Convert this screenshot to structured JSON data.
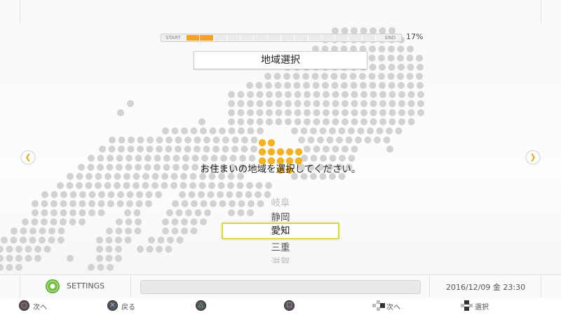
{
  "progress": {
    "start_label": "START",
    "end_label": "END",
    "percent_text": "17%",
    "percent": 17,
    "segments": 14,
    "filled_segments": 2,
    "fill_color": "#f4a420"
  },
  "title": "地域選択",
  "prompt": "お住まいの地域を選択してください。",
  "picker": {
    "items": [
      {
        "label": "岐阜",
        "state": "far"
      },
      {
        "label": "静岡",
        "state": "near"
      },
      {
        "label": "愛知",
        "state": "selected"
      },
      {
        "label": "三重",
        "state": "near"
      },
      {
        "label": "滋賀",
        "state": "far"
      }
    ],
    "selected_border_color": "#d9d64a"
  },
  "nav": {
    "left_icon": "chevron-left-icon",
    "right_icon": "chevron-right-icon",
    "accent_color": "#e6a21a"
  },
  "map": {
    "dot_color": "#d2d2d2",
    "highlight_color": "#f4b223",
    "highlighted_region": "愛知"
  },
  "settings_bar": {
    "label": "SETTINGS",
    "icon": "gear-icon",
    "datetime": "2016/12/09 金 23:30"
  },
  "button_bar": [
    {
      "icon": "circle-button-icon",
      "label": "次へ"
    },
    {
      "icon": "cross-button-icon",
      "label": "戻る"
    },
    {
      "icon": "triangle-button-icon",
      "label": ""
    },
    {
      "icon": "square-button-icon",
      "label": ""
    },
    {
      "icon": "dpad-right-icon",
      "label": "次へ"
    },
    {
      "icon": "dpad-updown-icon",
      "label": "選択"
    }
  ]
}
